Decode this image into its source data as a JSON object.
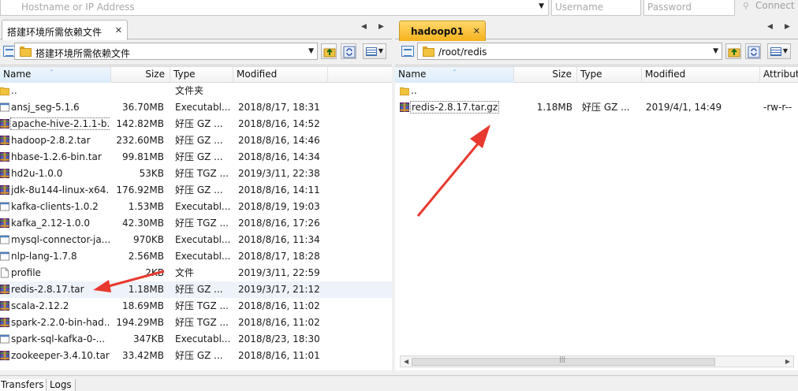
{
  "connection": {
    "host_placeholder": "Hostname or IP Address",
    "user_placeholder": "Username",
    "pass_placeholder": "Password",
    "connect_label": "Connect"
  },
  "left": {
    "tab_label": "搭建环境所需依赖文件",
    "path": "搭建环境所需依赖文件",
    "columns": [
      "Name",
      "Size",
      "Type",
      "Modified"
    ],
    "files": [
      {
        "name": "..",
        "size": "",
        "type": "文件夹",
        "modified": "",
        "icon": "folder-icon"
      },
      {
        "name": "ansj_seg-5.1.6",
        "size": "36.70MB",
        "type": "Executabl...",
        "modified": "2018/8/17, 18:31",
        "icon": "executable-icon"
      },
      {
        "name": "apache-hive-2.1.1-b...",
        "size": "142.82MB",
        "type": "好压 GZ ...",
        "modified": "2018/8/16, 14:52",
        "icon": "archive-icon"
      },
      {
        "name": "hadoop-2.8.2.tar",
        "size": "232.60MB",
        "type": "好压 GZ ...",
        "modified": "2018/8/16, 14:46",
        "icon": "archive-icon"
      },
      {
        "name": "hbase-1.2.6-bin.tar",
        "size": "99.81MB",
        "type": "好压 GZ ...",
        "modified": "2018/8/16, 14:34",
        "icon": "archive-icon"
      },
      {
        "name": "hd2u-1.0.0",
        "size": "53KB",
        "type": "好压 TGZ ...",
        "modified": "2019/3/11, 22:38",
        "icon": "archive-icon"
      },
      {
        "name": "jdk-8u144-linux-x64...",
        "size": "176.92MB",
        "type": "好压 GZ ...",
        "modified": "2018/8/16, 14:11",
        "icon": "archive-icon"
      },
      {
        "name": "kafka-clients-1.0.2",
        "size": "1.53MB",
        "type": "Executabl...",
        "modified": "2018/8/19, 19:03",
        "icon": "executable-icon"
      },
      {
        "name": "kafka_2.12-1.0.0",
        "size": "42.30MB",
        "type": "好压 TGZ ...",
        "modified": "2018/8/16, 17:26",
        "icon": "archive-icon"
      },
      {
        "name": "mysql-connector-ja...",
        "size": "970KB",
        "type": "Executabl...",
        "modified": "2018/8/16, 11:34",
        "icon": "executable-icon"
      },
      {
        "name": "nlp-lang-1.7.8",
        "size": "2.56MB",
        "type": "Executabl...",
        "modified": "2018/8/17, 18:28",
        "icon": "executable-icon"
      },
      {
        "name": "profile",
        "size": "2KB",
        "type": "文件",
        "modified": "2019/3/11, 22:59",
        "icon": "file-icon"
      },
      {
        "name": "redis-2.8.17.tar",
        "size": "1.18MB",
        "type": "好压 GZ ...",
        "modified": "2019/3/17, 21:12",
        "icon": "archive-icon"
      },
      {
        "name": "scala-2.12.2",
        "size": "18.69MB",
        "type": "好压 TGZ ...",
        "modified": "2018/8/16, 11:02",
        "icon": "archive-icon"
      },
      {
        "name": "spark-2.2.0-bin-had...",
        "size": "194.29MB",
        "type": "好压 TGZ ...",
        "modified": "2018/8/16, 11:02",
        "icon": "archive-icon"
      },
      {
        "name": "spark-sql-kafka-0-...",
        "size": "347KB",
        "type": "Executabl...",
        "modified": "2018/8/23, 18:30",
        "icon": "executable-icon"
      },
      {
        "name": "zookeeper-3.4.10.tar",
        "size": "33.42MB",
        "type": "好压 GZ ...",
        "modified": "2018/8/16, 11:01",
        "icon": "archive-icon"
      }
    ]
  },
  "right": {
    "tab_label": "hadoop01",
    "path": "/root/redis",
    "columns": [
      "Name",
      "Size",
      "Type",
      "Modified",
      "Attribut"
    ],
    "files": [
      {
        "name": "..",
        "size": "",
        "type": "",
        "modified": "",
        "attr": "",
        "icon": "folder-icon"
      },
      {
        "name": "redis-2.8.17.tar.gz",
        "size": "1.18MB",
        "type": "好压 GZ ...",
        "modified": "2019/4/1, 14:49",
        "attr": "-rw-r--",
        "icon": "archive-icon"
      }
    ]
  },
  "bottom_tabs": [
    "Transfers",
    "Logs"
  ],
  "colors": {
    "accent_tab": "#f5b21c",
    "arrow": "#e8392e"
  }
}
